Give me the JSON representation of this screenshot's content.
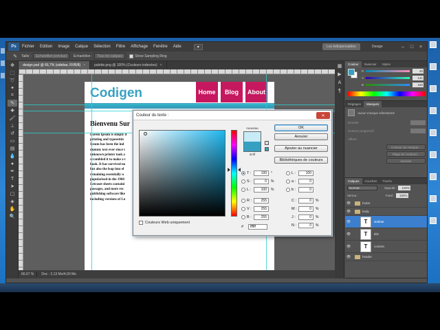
{
  "menubar": {
    "logo": "Ps",
    "items": [
      "Fichier",
      "Edition",
      "Image",
      "Calque",
      "Sélection",
      "Filtre",
      "Affichage",
      "Fenêtre",
      "Aide"
    ],
    "workspace_active": "Les indispensables",
    "workspace_other": "Design",
    "win_controls": [
      "–",
      "□",
      "×"
    ]
  },
  "options_bar": {
    "taille_label": "Taille :",
    "taille_value": "Echantillon ponctuel",
    "echantillon_label": "Echantillon :",
    "echantillon_value": "Tous les calques",
    "sampling_ring": "Show Sampling Ring"
  },
  "doc_tabs": [
    {
      "label": "design.psd @ 66,7% (sidebar, RVB/8)",
      "active": true
    },
    {
      "label": "palette.png @ 100% (Couleurs indexées)",
      "active": false
    }
  ],
  "document": {
    "logo": "Codigen",
    "nav": [
      "Home",
      "Blog",
      "About"
    ],
    "title": "Bienvenu Sur",
    "body_lines": [
      "Lorem Ipsum is simply d",
      "printing and typesettin",
      "Ipsum has been the ind",
      "dummy text ever since t",
      "unknown printer took a",
      "scrambled it to make a t",
      "book. It has survived no",
      "but also the leap into el",
      "remaining essentially u",
      "popularised in the 1960",
      "Letraset sheets containi",
      "passages, and more rec",
      "publishing software like",
      "including versions of Lo"
    ]
  },
  "status": {
    "zoom": "66,67 %",
    "doc_size": "Doc : 2,13 Mo/4,00 Mo"
  },
  "color_panel": {
    "tabs": [
      "Couleur",
      "Nuancier",
      "Styles"
    ],
    "channels": [
      {
        "name": "R",
        "value": "45"
      },
      {
        "name": "V",
        "value": "141"
      },
      {
        "name": "B",
        "value": "180"
      }
    ]
  },
  "masks_panel": {
    "tabs": [
      "Réglages",
      "Masques"
    ],
    "no_mask": "Aucun masque sélectionné",
    "density": "Densité :",
    "contour": "Contour progressif :",
    "affiner": "Affiner :",
    "btn_contour": "Contour du masque...",
    "btn_plage": "Plage de couleurs...",
    "btn_inverser": "Inverser"
  },
  "layers_panel": {
    "tabs": [
      "Calques",
      "Couches",
      "Tracés"
    ],
    "blend_mode": "Normal",
    "opacity_label": "Opacité :",
    "opacity": "100%",
    "lock_label": "Verrou :",
    "fill_label": "Fond :",
    "fill": "100%",
    "layers": [
      {
        "name": "footer",
        "kind": "folder",
        "selected": false
      },
      {
        "name": "body",
        "kind": "folder",
        "selected": false
      },
      {
        "name": "sidebar",
        "kind": "text",
        "selected": true
      },
      {
        "name": "title",
        "kind": "text",
        "selected": false
      },
      {
        "name": "content",
        "kind": "text",
        "selected": false
      },
      {
        "name": "header",
        "kind": "folder",
        "selected": false
      }
    ]
  },
  "dialog": {
    "title": "Couleur du texte :",
    "new_label": "nouveau",
    "hex_diff": "actif",
    "buttons": {
      "ok": "OK",
      "cancel": "Annuler",
      "add": "Ajouter au nuancier",
      "libraries": "Bibliothèques de couleurs"
    },
    "hsb": [
      {
        "name": "T :",
        "value": "199",
        "unit": "°",
        "checked": true
      },
      {
        "name": "S :",
        "value": "0",
        "unit": "%",
        "checked": false
      },
      {
        "name": "L :",
        "value": "100",
        "unit": "%",
        "checked": false
      }
    ],
    "rgb": [
      {
        "name": "R :",
        "value": "255",
        "checked": false
      },
      {
        "name": "V :",
        "value": "255",
        "checked": false
      },
      {
        "name": "B :",
        "value": "255",
        "checked": false
      }
    ],
    "lab": [
      {
        "name": "L :",
        "value": "100"
      },
      {
        "name": "a :",
        "value": "0"
      },
      {
        "name": "b :",
        "value": "0"
      }
    ],
    "cmyk": [
      {
        "name": "C :",
        "value": "0",
        "unit": "%"
      },
      {
        "name": "M :",
        "value": "0",
        "unit": "%"
      },
      {
        "name": "J :",
        "value": "0",
        "unit": "%"
      },
      {
        "name": "N :",
        "value": "0",
        "unit": "%"
      }
    ],
    "hex_label": "#",
    "hex": "ffffff",
    "web_only": "Couleurs Web uniquement"
  },
  "colors": {
    "accent": "#37a1c2",
    "nav": "#c6185f",
    "selected_layer": "#3b7fce"
  }
}
